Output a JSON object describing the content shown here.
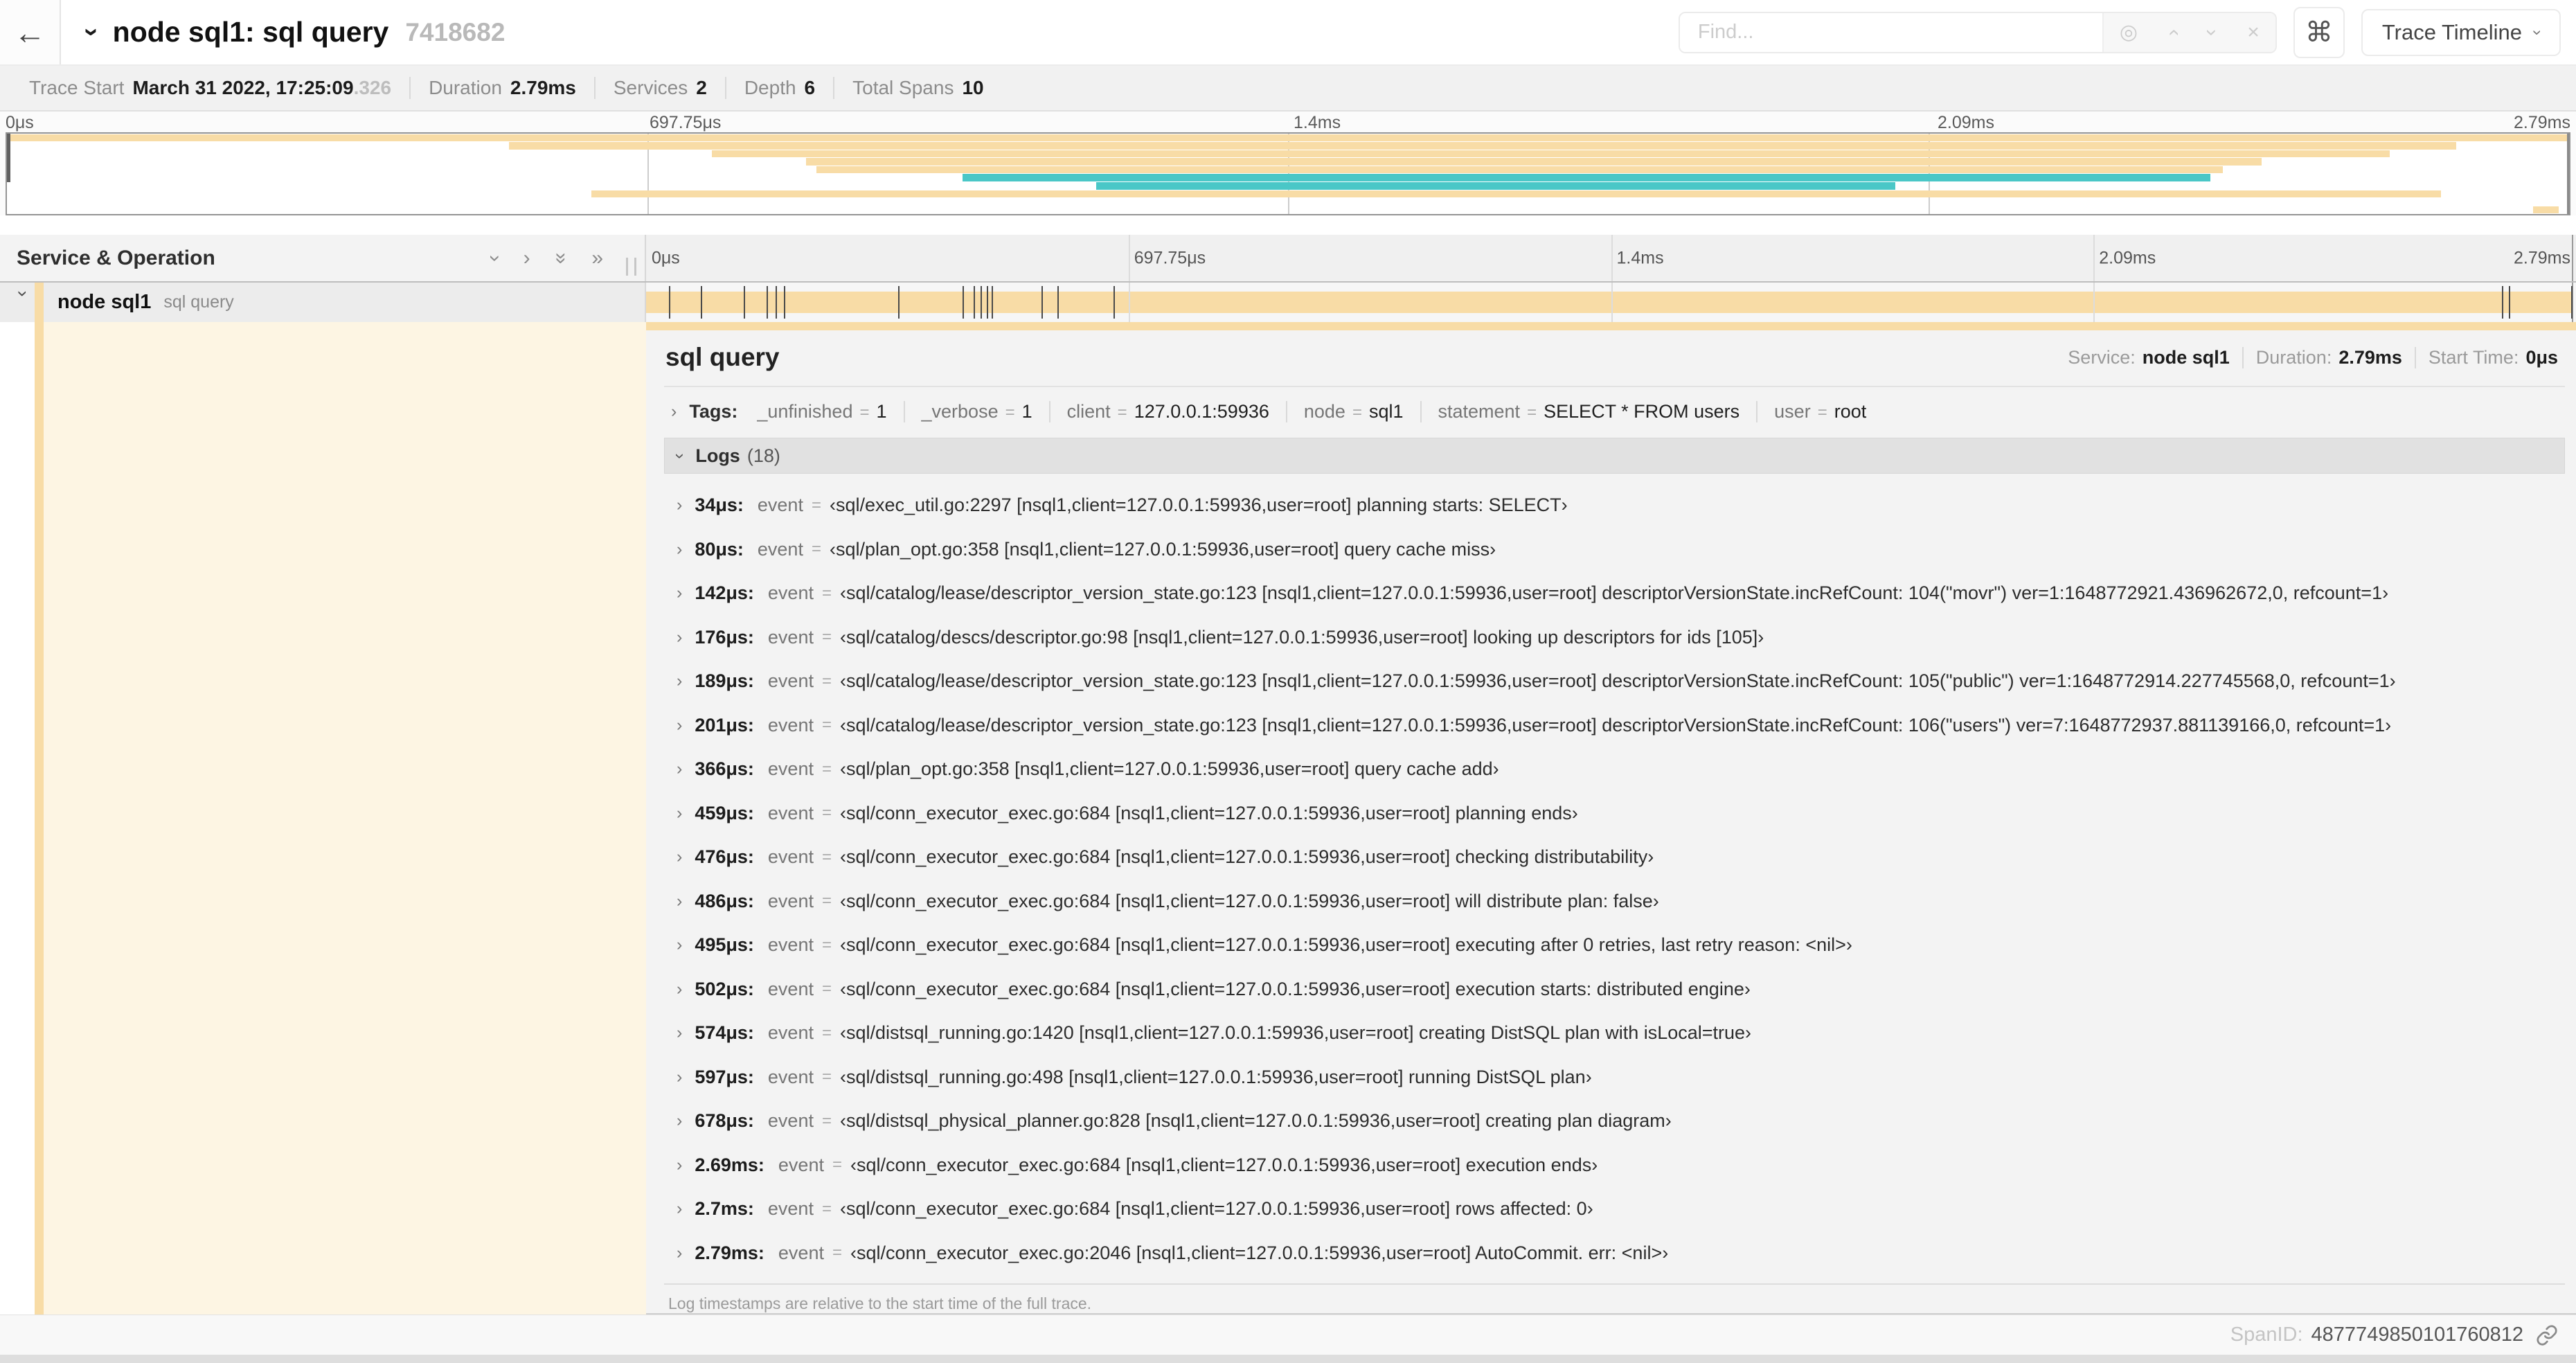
{
  "header": {
    "title": "node sql1: sql query",
    "trace_id": "7418682",
    "find_placeholder": "Find...",
    "view_selector_label": "Trace Timeline"
  },
  "icons": {
    "back": "←",
    "chevron": "›",
    "double_chevron": "»",
    "locate": "◎",
    "close": "×",
    "command": "⌘"
  },
  "summary": {
    "items": [
      {
        "label": "Trace Start",
        "value": "March 31 2022, 17:25:09",
        "muted_suffix": ".326"
      },
      {
        "label": "Duration",
        "value": "2.79ms"
      },
      {
        "label": "Services",
        "value": "2"
      },
      {
        "label": "Depth",
        "value": "6"
      },
      {
        "label": "Total Spans",
        "value": "10"
      }
    ]
  },
  "minimap": {
    "ticks": [
      "0μs",
      "697.75μs",
      "1.4ms",
      "2.09ms",
      "2.79ms"
    ],
    "spans": [
      {
        "start": 0,
        "end": 100,
        "color": "#f8dca6"
      },
      {
        "start": 19.6,
        "end": 95.6,
        "color": "#f8dca6"
      },
      {
        "start": 27.5,
        "end": 93.0,
        "color": "#f8dca6"
      },
      {
        "start": 31.2,
        "end": 88.0,
        "color": "#f8dca6"
      },
      {
        "start": 31.6,
        "end": 86.5,
        "color": "#f8dca6"
      },
      {
        "start": 37.3,
        "end": 86.0,
        "color": "#4ac7c7"
      },
      {
        "start": 42.5,
        "end": 73.7,
        "color": "#4ac7c7"
      },
      {
        "start": 22.8,
        "end": 95.0,
        "color": "#f8dca6"
      },
      {
        "start": 0,
        "end": 0,
        "color": "#f8dca6"
      },
      {
        "start": 98.6,
        "end": 99.6,
        "color": "#f8dca6"
      }
    ]
  },
  "timeline": {
    "column_header": "Service & Operation",
    "ticks": [
      "0μs",
      "697.75μs",
      "1.4ms",
      "2.09ms",
      "2.79ms"
    ],
    "duration_us": 2790
  },
  "span_row": {
    "service": "node sql1",
    "operation": "sql query"
  },
  "detail": {
    "title": "sql query",
    "meta": [
      {
        "label": "Service:",
        "value": "node sql1"
      },
      {
        "label": "Duration:",
        "value": "2.79ms"
      },
      {
        "label": "Start Time:",
        "value": "0μs"
      }
    ],
    "tags_label": "Tags:",
    "tags": [
      {
        "key": "_unfinished",
        "value": "1"
      },
      {
        "key": "_verbose",
        "value": "1"
      },
      {
        "key": "client",
        "value": "127.0.0.1:59936"
      },
      {
        "key": "node",
        "value": "sql1"
      },
      {
        "key": "statement",
        "value": "SELECT * FROM users"
      },
      {
        "key": "user",
        "value": "root"
      }
    ],
    "logs_label": "Logs",
    "logs_count": "(18)",
    "logs": [
      {
        "time_label": "34μs:",
        "t_us": 34,
        "key": "event",
        "value": "‹sql/exec_util.go:2297 [nsql1,client=127.0.0.1:59936,user=root] planning starts: SELECT›"
      },
      {
        "time_label": "80μs:",
        "t_us": 80,
        "key": "event",
        "value": "‹sql/plan_opt.go:358 [nsql1,client=127.0.0.1:59936,user=root] query cache miss›"
      },
      {
        "time_label": "142μs:",
        "t_us": 142,
        "key": "event",
        "value": "‹sql/catalog/lease/descriptor_version_state.go:123 [nsql1,client=127.0.0.1:59936,user=root] descriptorVersionState.incRefCount: 104(\"movr\") ver=1:1648772921.436962672,0, refcount=1›"
      },
      {
        "time_label": "176μs:",
        "t_us": 176,
        "key": "event",
        "value": "‹sql/catalog/descs/descriptor.go:98 [nsql1,client=127.0.0.1:59936,user=root] looking up descriptors for ids [105]›"
      },
      {
        "time_label": "189μs:",
        "t_us": 189,
        "key": "event",
        "value": "‹sql/catalog/lease/descriptor_version_state.go:123 [nsql1,client=127.0.0.1:59936,user=root] descriptorVersionState.incRefCount: 105(\"public\") ver=1:1648772914.227745568,0, refcount=1›"
      },
      {
        "time_label": "201μs:",
        "t_us": 201,
        "key": "event",
        "value": "‹sql/catalog/lease/descriptor_version_state.go:123 [nsql1,client=127.0.0.1:59936,user=root] descriptorVersionState.incRefCount: 106(\"users\") ver=7:1648772937.881139166,0, refcount=1›"
      },
      {
        "time_label": "366μs:",
        "t_us": 366,
        "key": "event",
        "value": "‹sql/plan_opt.go:358 [nsql1,client=127.0.0.1:59936,user=root] query cache add›"
      },
      {
        "time_label": "459μs:",
        "t_us": 459,
        "key": "event",
        "value": "‹sql/conn_executor_exec.go:684 [nsql1,client=127.0.0.1:59936,user=root] planning ends›"
      },
      {
        "time_label": "476μs:",
        "t_us": 476,
        "key": "event",
        "value": "‹sql/conn_executor_exec.go:684 [nsql1,client=127.0.0.1:59936,user=root] checking distributability›"
      },
      {
        "time_label": "486μs:",
        "t_us": 486,
        "key": "event",
        "value": "‹sql/conn_executor_exec.go:684 [nsql1,client=127.0.0.1:59936,user=root] will distribute plan: false›"
      },
      {
        "time_label": "495μs:",
        "t_us": 495,
        "key": "event",
        "value": "‹sql/conn_executor_exec.go:684 [nsql1,client=127.0.0.1:59936,user=root] executing after 0 retries, last retry reason: <nil>›"
      },
      {
        "time_label": "502μs:",
        "t_us": 502,
        "key": "event",
        "value": "‹sql/conn_executor_exec.go:684 [nsql1,client=127.0.0.1:59936,user=root] execution starts: distributed engine›"
      },
      {
        "time_label": "574μs:",
        "t_us": 574,
        "key": "event",
        "value": "‹sql/distsql_running.go:1420 [nsql1,client=127.0.0.1:59936,user=root] creating DistSQL plan with isLocal=true›"
      },
      {
        "time_label": "597μs:",
        "t_us": 597,
        "key": "event",
        "value": "‹sql/distsql_running.go:498 [nsql1,client=127.0.0.1:59936,user=root] running DistSQL plan›"
      },
      {
        "time_label": "678μs:",
        "t_us": 678,
        "key": "event",
        "value": "‹sql/distsql_physical_planner.go:828 [nsql1,client=127.0.0.1:59936,user=root] creating plan diagram›"
      },
      {
        "time_label": "2.69ms:",
        "t_us": 2690,
        "key": "event",
        "value": "‹sql/conn_executor_exec.go:684 [nsql1,client=127.0.0.1:59936,user=root] execution ends›"
      },
      {
        "time_label": "2.7ms:",
        "t_us": 2700,
        "key": "event",
        "value": "‹sql/conn_executor_exec.go:684 [nsql1,client=127.0.0.1:59936,user=root] rows affected: 0›"
      },
      {
        "time_label": "2.79ms:",
        "t_us": 2790,
        "key": "event",
        "value": "‹sql/conn_executor_exec.go:2046 [nsql1,client=127.0.0.1:59936,user=root] AutoCommit. err: <nil>›"
      }
    ],
    "logs_note": "Log timestamps are relative to the start time of the full trace.",
    "span_id_label": "SpanID:",
    "span_id": "4877749850101760812"
  },
  "ui": {
    "equals": "="
  },
  "colors": {
    "span_orange": "#f8dca6",
    "span_teal": "#4ac7c7",
    "cream_tint": "#fdf5e3"
  }
}
